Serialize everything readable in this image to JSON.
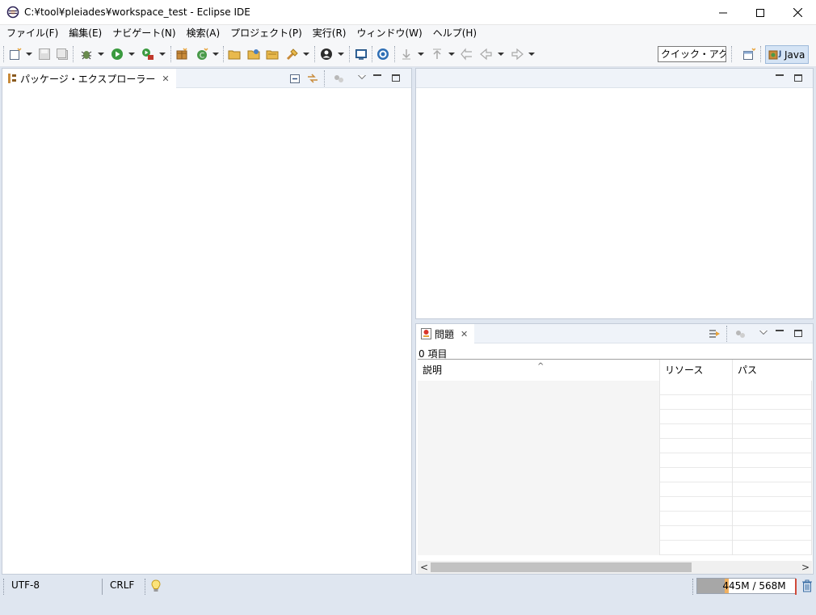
{
  "window": {
    "title": "C:¥tool¥pleiades¥workspace_test - Eclipse IDE"
  },
  "menubar": {
    "items": [
      {
        "label": "ファイル(F)"
      },
      {
        "label": "編集(E)"
      },
      {
        "label": "ナビゲート(N)"
      },
      {
        "label": "検索(A)"
      },
      {
        "label": "プロジェクト(P)"
      },
      {
        "label": "実行(R)"
      },
      {
        "label": "ウィンドウ(W)"
      },
      {
        "label": "ヘルプ(H)"
      }
    ]
  },
  "toolbar": {
    "quick_access": "クイック・アクセス",
    "perspective": "Java"
  },
  "package_explorer": {
    "tab_label": "パッケージ・エクスプローラー"
  },
  "problems": {
    "tab_label": "問題",
    "item_count": "0 項目",
    "columns": [
      "説明",
      "リソース",
      "パス"
    ],
    "sort_indicator": "^"
  },
  "statusbar": {
    "encoding": "UTF-8",
    "line_delimiter": "CRLF",
    "heap": "445M / 568M",
    "heap_used_fraction": 0.28
  },
  "icons": {
    "app": "eclipse-icon",
    "minimize": "minimize-icon",
    "maximize": "maximize-icon",
    "close": "close-icon"
  }
}
